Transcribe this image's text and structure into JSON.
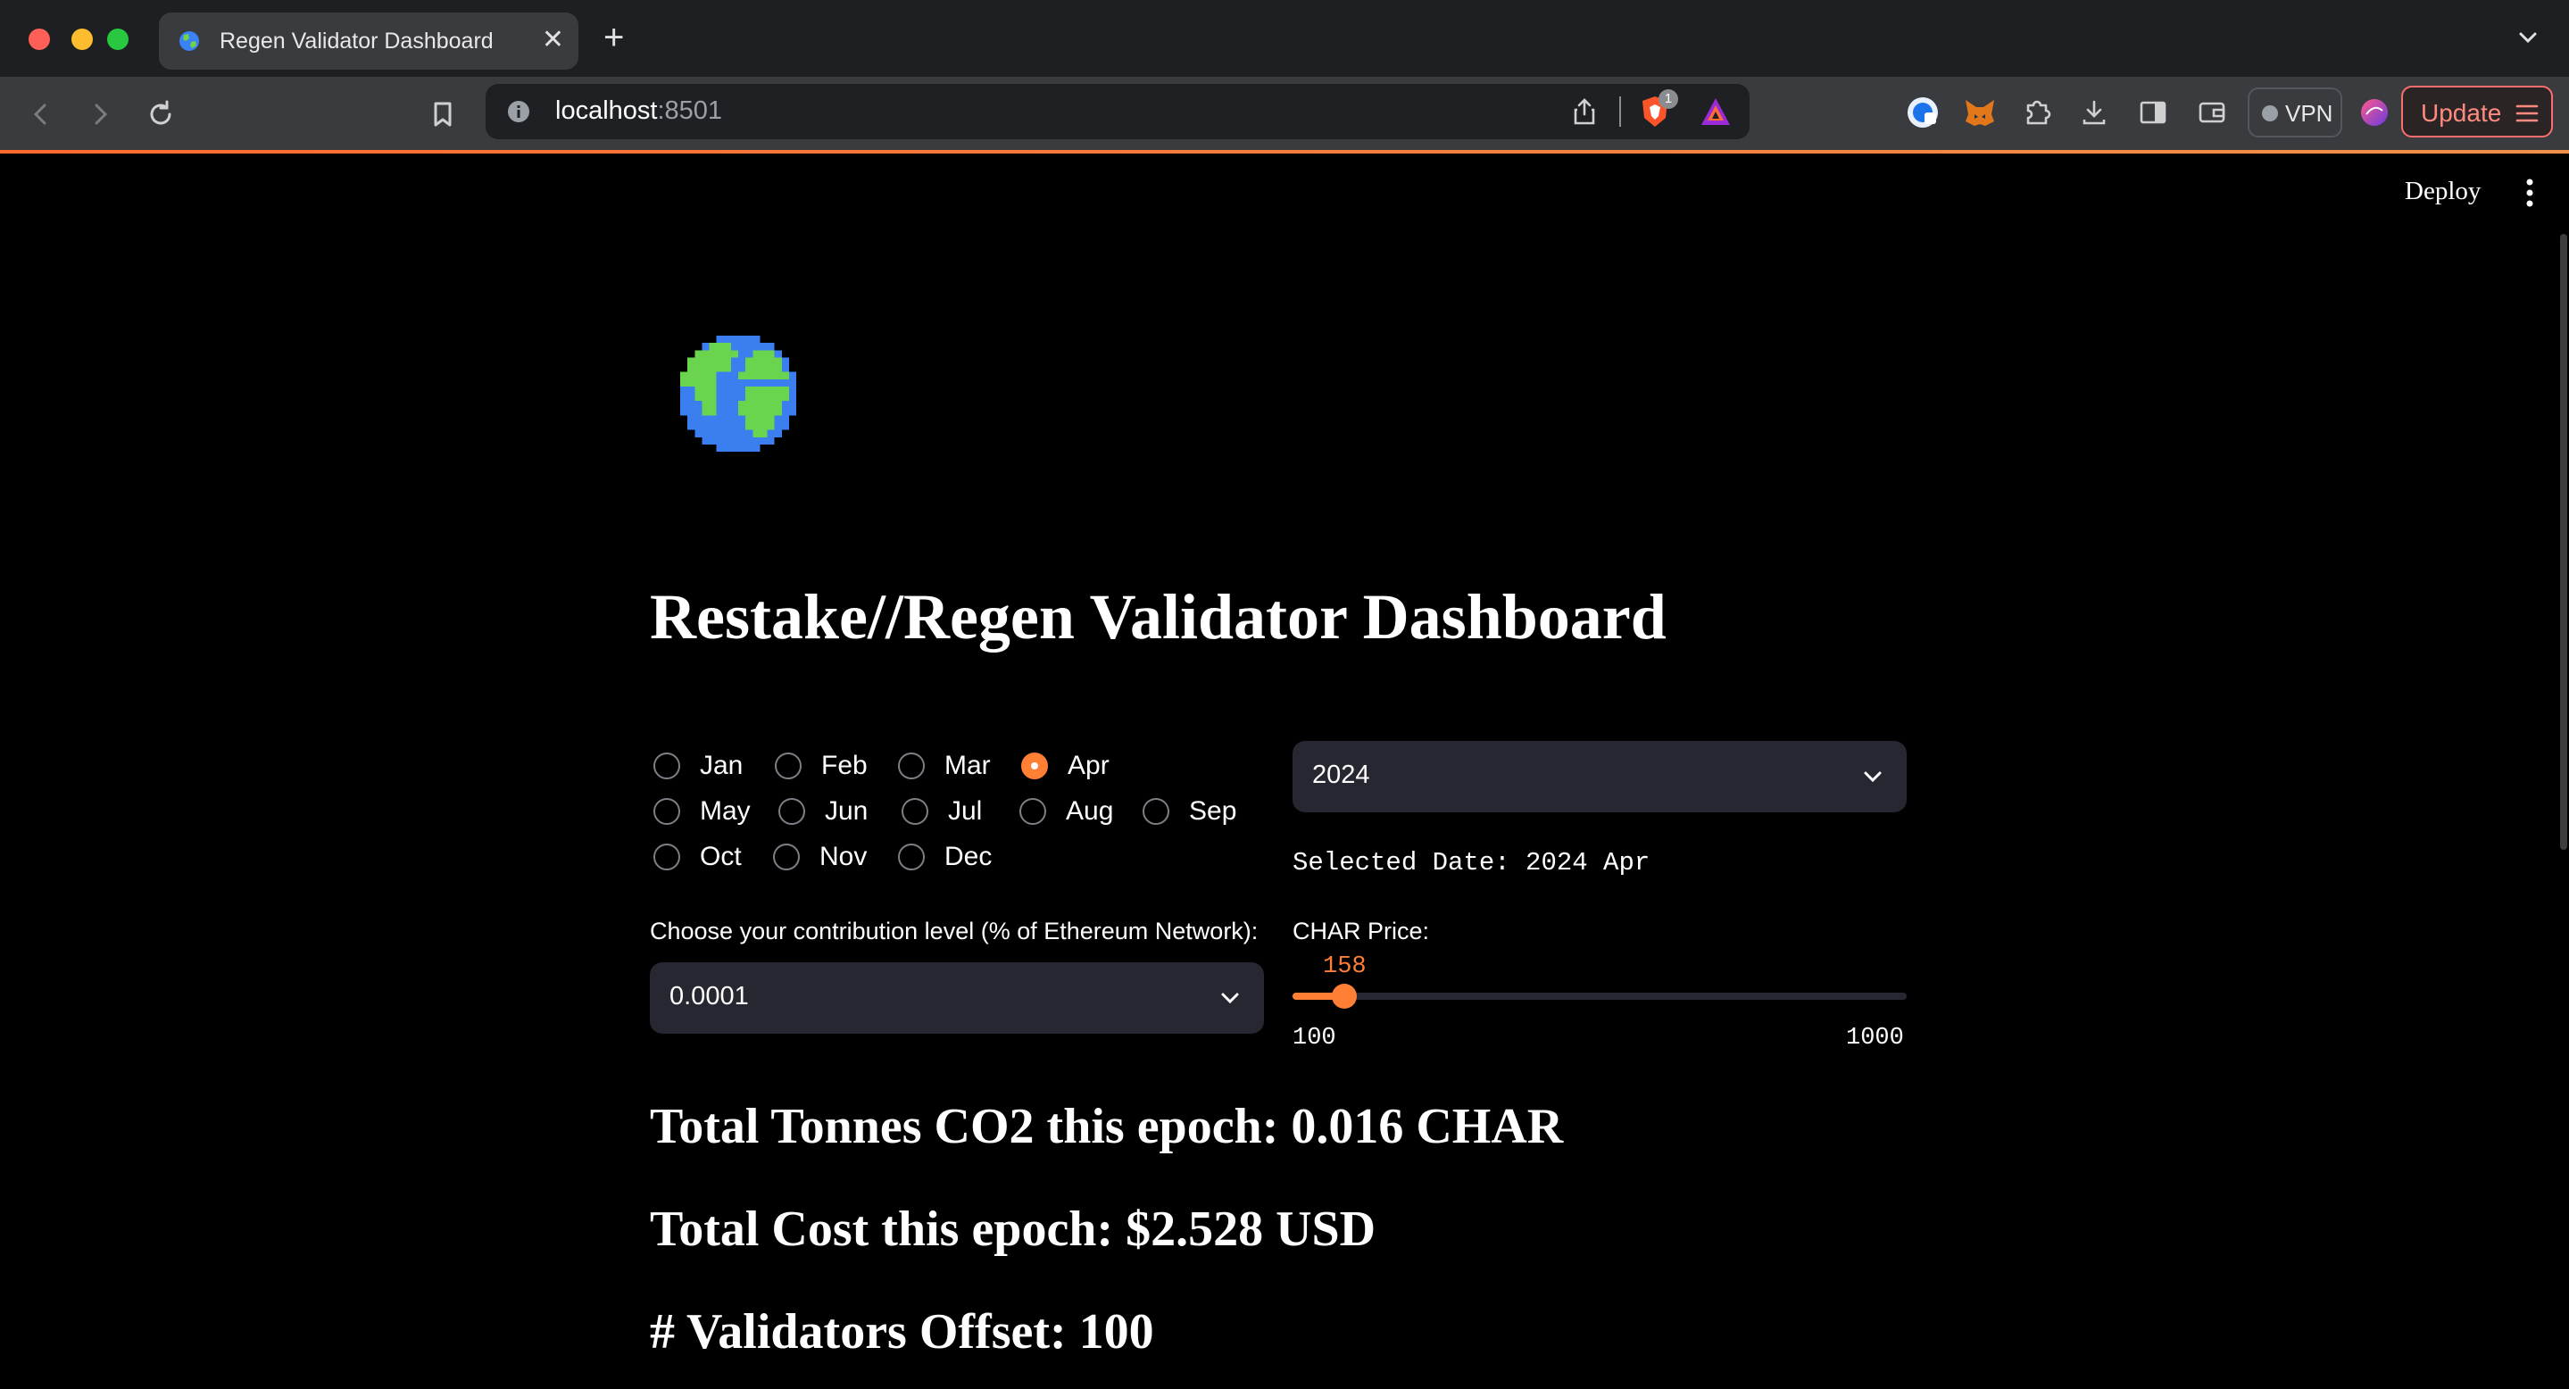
{
  "browser": {
    "tab_title": "Regen Validator Dashboard",
    "tab_close": "✕",
    "new_tab": "+",
    "url_host": "localhost",
    "url_port": ":8501",
    "shields_badge": "1",
    "vpn_label": "VPN",
    "update_label": "Update",
    "colors": {
      "update_accent": "#ff8a80",
      "brave_orange": "#fb542b"
    }
  },
  "app": {
    "deploy_label": "Deploy",
    "title": "Restake//Regen Validator Dashboard",
    "months": [
      "Jan",
      "Feb",
      "Mar",
      "Apr",
      "May",
      "Jun",
      "Jul",
      "Aug",
      "Sep",
      "Oct",
      "Nov",
      "Dec"
    ],
    "selected_month": "Apr",
    "year_select": {
      "value": "2024"
    },
    "selected_date_text": "Selected Date: 2024 Apr",
    "contribution": {
      "label": "Choose your contribution level (% of Ethereum Network):",
      "value": "0.0001"
    },
    "char_price": {
      "label": "CHAR Price:",
      "value": 158,
      "min": 100,
      "max": 1000
    },
    "stats": {
      "tonnes": "Total Tonnes CO2 this epoch: 0.016 CHAR",
      "cost": "Total Cost this epoch: $2.528 USD",
      "validators": "# Validators Offset: 100"
    },
    "colors": {
      "accent": "#ff7f35",
      "background": "#000000",
      "input_bg": "#262730"
    }
  }
}
